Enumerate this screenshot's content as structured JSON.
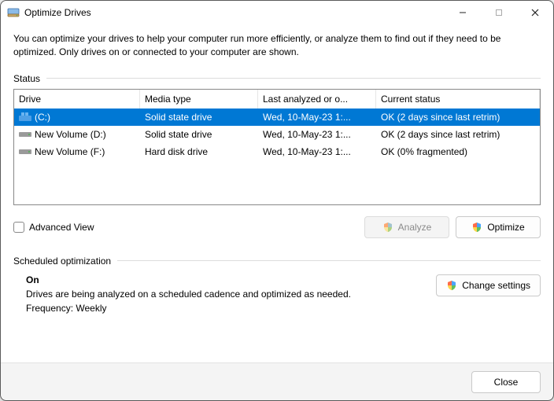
{
  "window": {
    "title": "Optimize Drives"
  },
  "description": "You can optimize your drives to help your computer run more efficiently, or analyze them to find out if they need to be optimized. Only drives on or connected to your computer are shown.",
  "status": {
    "label": "Status",
    "columns": {
      "drive": "Drive",
      "media": "Media type",
      "last": "Last analyzed or o...",
      "status": "Current status"
    },
    "rows": [
      {
        "icon": "os-drive",
        "name": "(C:)",
        "media": "Solid state drive",
        "last": "Wed, 10-May-23 1:...",
        "status": "OK (2 days since last retrim)",
        "selected": true
      },
      {
        "icon": "hdd",
        "name": "New Volume (D:)",
        "media": "Solid state drive",
        "last": "Wed, 10-May-23 1:...",
        "status": "OK (2 days since last retrim)",
        "selected": false
      },
      {
        "icon": "hdd",
        "name": "New Volume (F:)",
        "media": "Hard disk drive",
        "last": "Wed, 10-May-23 1:...",
        "status": "OK (0% fragmented)",
        "selected": false
      }
    ]
  },
  "advanced_view_label": "Advanced View",
  "buttons": {
    "analyze": "Analyze",
    "optimize": "Optimize",
    "change_settings": "Change settings",
    "close": "Close"
  },
  "scheduled": {
    "label": "Scheduled optimization",
    "state": "On",
    "desc": "Drives are being analyzed on a scheduled cadence and optimized as needed.",
    "freq": "Frequency: Weekly"
  }
}
